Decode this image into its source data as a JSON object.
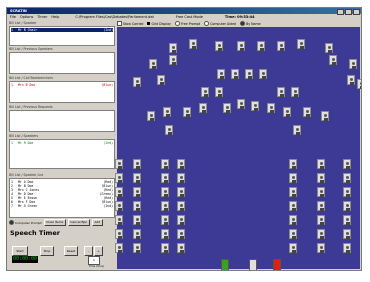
{
  "window": {
    "title": "SCRATIN"
  },
  "menu": {
    "items": [
      "File",
      "Options",
      "Timer",
      "Help"
    ],
    "path": "C:\\Program Files\\Cas\\Debates\\Parliament.dat",
    "mode": "Free Cast Mode",
    "time": "Time: 09:53:44"
  },
  "options": [
    {
      "label": "Stow Carried",
      "kind": "checkbox"
    },
    {
      "label": "Grid Display",
      "kind": "swatch"
    },
    {
      "label": "Free Prompt",
      "kind": "radio",
      "on": false
    },
    {
      "label": "Computer Aided",
      "kind": "radio",
      "on": false
    },
    {
      "label": "By Name",
      "kind": "radio",
      "on": true
    }
  ],
  "sections": [
    {
      "title": "Bill List / Speaker",
      "rows": [
        {
          "n": "1",
          "name": "Mr B Chair",
          "party": "(Ind)"
        }
      ],
      "selected": true
    },
    {
      "title": "Bill List / Previous Speakers",
      "rows": []
    },
    {
      "title": "Bill List / Call Backbenchers",
      "rows": [
        {
          "n": "1",
          "name": "Mrs B Doe",
          "party": "(Blue)",
          "color": "red"
        }
      ]
    },
    {
      "title": "Bill List / Previous Requests",
      "rows": []
    },
    {
      "title": "Bill List / Speakers",
      "rows": [
        {
          "n": "1",
          "name": "Mr R Doe",
          "party": "(Ind)",
          "color": "green"
        }
      ]
    },
    {
      "title": "Bill List / Speaker List",
      "rows": [
        {
          "n": "1",
          "name": "Mr A Doe",
          "party": "(Red)"
        },
        {
          "n": "2",
          "name": "Mr B Doe",
          "party": "(Blue)"
        },
        {
          "n": "3",
          "name": "Mrs C Jones",
          "party": "(Red)"
        },
        {
          "n": "4",
          "name": "Mr D Doe",
          "party": "(Green)"
        },
        {
          "n": "5",
          "name": "Mr E Brown",
          "party": "(Red)"
        },
        {
          "n": "6",
          "name": "Mrs F Doe",
          "party": "(Blue)"
        },
        {
          "n": "7",
          "name": "Mr G Green",
          "party": "(Ind)"
        }
      ]
    }
  ],
  "panel_buttons": [
    {
      "label": "Computer Prompt",
      "kind": "radio"
    },
    {
      "label": "Clear Items",
      "kind": "button"
    },
    {
      "label": "Cancel Bpn",
      "kind": "button"
    },
    {
      "label": "Add",
      "kind": "button"
    }
  ],
  "speech_timer": {
    "title": "Speech Timer",
    "start": "Start",
    "stop": "Stop",
    "reset": "Reset",
    "minus": "-",
    "plus": "+",
    "display": "00:00:00",
    "minutes": "1",
    "minutes_label": "Time (mins)"
  },
  "chamber": {
    "background": "#3c3a94",
    "podium_colors": [
      "#3aa020",
      "#e0e0e0",
      "#e02010"
    ]
  }
}
